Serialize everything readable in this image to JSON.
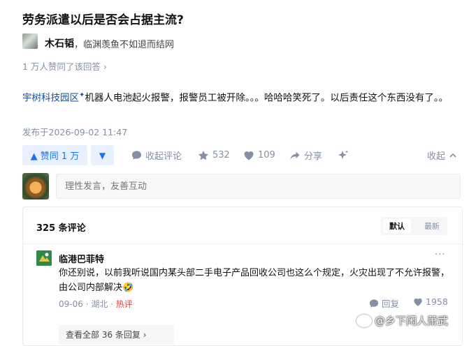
{
  "question": {
    "title": "劳务派遣以后是否会占据主流?"
  },
  "author": {
    "name": "木石韬",
    "bio": "，临渊羡鱼不如退而结网"
  },
  "voters_text": "1 万人赞同了该回答 ›",
  "answer": {
    "link_text": "宇树科技园区",
    "spark": "✦",
    "text": "机器人电池起火报警，报警员工被开除。。。哈哈哈笑死了。以后责任这个东西没有了。。",
    "published": "发布于2026-09-02 11:47"
  },
  "actions": {
    "vote_up": "▲ 赞同 1 万",
    "vote_down": "▼",
    "comment_close": "收起评论",
    "favorites": "532",
    "likes": "109",
    "share": "分享",
    "collapse": "收起"
  },
  "comment_input": {
    "placeholder": "理性发言，友善互动"
  },
  "comments": {
    "count": "325 条评论",
    "sort": {
      "default": "默认",
      "latest": "最新"
    },
    "items": [
      {
        "name": "临港巴菲特",
        "text": "你还别说，以前我听说国内某头部二手电子产品回收公司也这么个规定，火灾出现了不允许报警，由公司内部解决🤣",
        "date": "09-06",
        "location": "湖北",
        "hot": "热评",
        "reply": "回复",
        "likes": "1958"
      }
    ],
    "view_all": "查看全部 36 条回复 ›"
  },
  "watermark": "@乡下闲人萧武",
  "colors": {
    "accent": "#1772f6",
    "accent_bg": "#e8f1fd",
    "muted": "#8590a6",
    "link": "#175199",
    "hot": "#f1403c"
  }
}
